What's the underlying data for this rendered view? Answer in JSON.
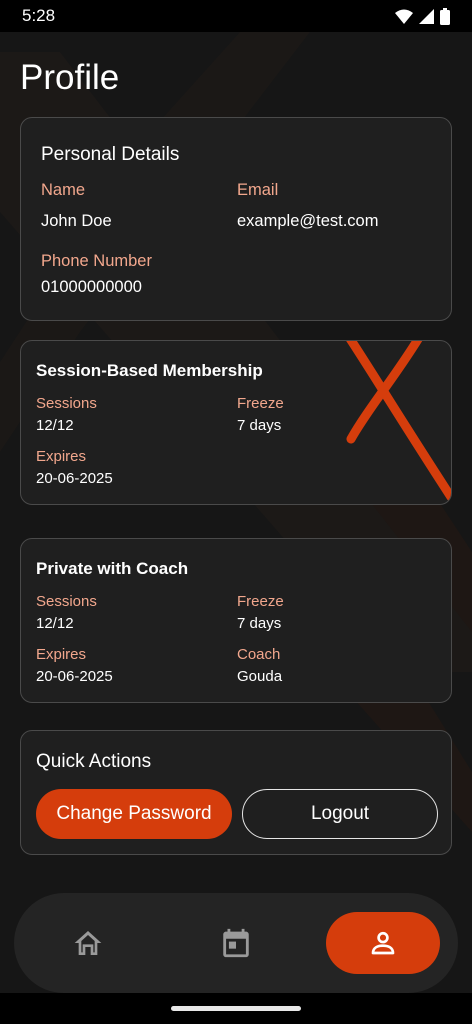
{
  "status_bar": {
    "time": "5:28"
  },
  "page": {
    "title": "Profile"
  },
  "personal_details": {
    "title": "Personal Details",
    "name_label": "Name",
    "name_value": "John Doe",
    "email_label": "Email",
    "email_value": "example@test.com",
    "phone_label": "Phone Number",
    "phone_value": "01000000000"
  },
  "memberships": [
    {
      "title": "Session-Based Membership",
      "sessions_label": "Sessions",
      "sessions_value": "12/12",
      "freeze_label": "Freeze",
      "freeze_value": "7 days",
      "expires_label": "Expires",
      "expires_value": "20-06-2025"
    },
    {
      "title": "Private with Coach",
      "sessions_label": "Sessions",
      "sessions_value": "12/12",
      "freeze_label": "Freeze",
      "freeze_value": "7 days",
      "expires_label": "Expires",
      "expires_value": "20-06-2025",
      "coach_label": "Coach",
      "coach_value": "Gouda"
    }
  ],
  "quick_actions": {
    "title": "Quick Actions",
    "change_password_label": "Change Password",
    "logout_label": "Logout"
  },
  "bottom_nav": {
    "items": [
      {
        "icon": "home-icon",
        "active": false
      },
      {
        "icon": "calendar-icon",
        "active": false
      },
      {
        "icon": "person-icon",
        "active": true
      }
    ]
  },
  "colors": {
    "accent": "#d53d0c",
    "label": "#f2a78d",
    "card_bg": "#1f1f1f",
    "page_bg": "#161616"
  }
}
